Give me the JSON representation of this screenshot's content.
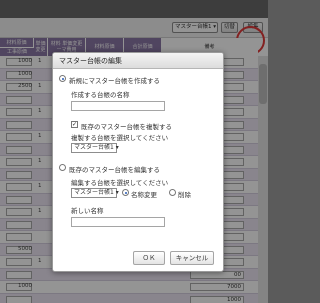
{
  "toolbar": {
    "master_select": "マスター台帳1 ▾",
    "copy_label": "切替",
    "edit_label": "編集"
  },
  "grid": {
    "headers": {
      "material_cost": "材料原価",
      "unit_change": "単価 変更",
      "material_cost_per_unit": "材料 単価変更 ーマ費用",
      "material_cost_2": "材料原価",
      "total_cost": "合計原価",
      "construction_cost": "工事原価",
      "remarks": "備考"
    },
    "rows": [
      {
        "num": "1000",
        "one": "1",
        "right": ""
      },
      {
        "num": "1000",
        "one": "",
        "right": ""
      },
      {
        "num": "2500",
        "one": "1",
        "right": ""
      },
      {
        "num": "",
        "one": "",
        "right": ""
      },
      {
        "num": "",
        "one": "1",
        "right": ""
      },
      {
        "num": "",
        "one": "",
        "right": ""
      },
      {
        "num": "",
        "one": "1",
        "right": ""
      },
      {
        "num": "",
        "one": "",
        "right": ""
      },
      {
        "num": "",
        "one": "1",
        "right": ""
      },
      {
        "num": "",
        "one": "",
        "right": ""
      },
      {
        "num": "",
        "one": "1",
        "right": ""
      },
      {
        "num": "",
        "one": "",
        "right": ""
      },
      {
        "num": "",
        "one": "1",
        "right": ""
      },
      {
        "num": "",
        "one": "",
        "right": ""
      },
      {
        "num": "",
        "one": "",
        "right": ""
      },
      {
        "num": "5000",
        "one": "",
        "right": ""
      },
      {
        "num": "",
        "one": "1",
        "right": ""
      },
      {
        "num": "",
        "one": "",
        "right": "00"
      },
      {
        "num": "1000",
        "one": "",
        "right": "7000"
      },
      {
        "num": "",
        "one": "",
        "right": "1000"
      }
    ]
  },
  "dialog": {
    "title": "マスター台帳の編集",
    "create_radio_label": "新規にマスター台帳を作成する",
    "create_name_label": "作成する台帳の名称",
    "create_name_value": "",
    "copy_checkbox_label": "既存のマスター台帳を複製する",
    "copy_select_prompt": "複製する台帳を選択してください",
    "copy_select_value": "マスター台帳1 ▾",
    "edit_radio_label": "既存のマスター台帳を編集する",
    "edit_select_prompt": "編集する台帳を選択してください",
    "edit_select_value": "マスター台帳1 ▾",
    "rename_radio_label": "名称変更",
    "delete_radio_label": "削除",
    "new_name_label": "新しい名称",
    "new_name_value": "",
    "ok_label": "ＯＫ",
    "cancel_label": "キャンセル"
  }
}
